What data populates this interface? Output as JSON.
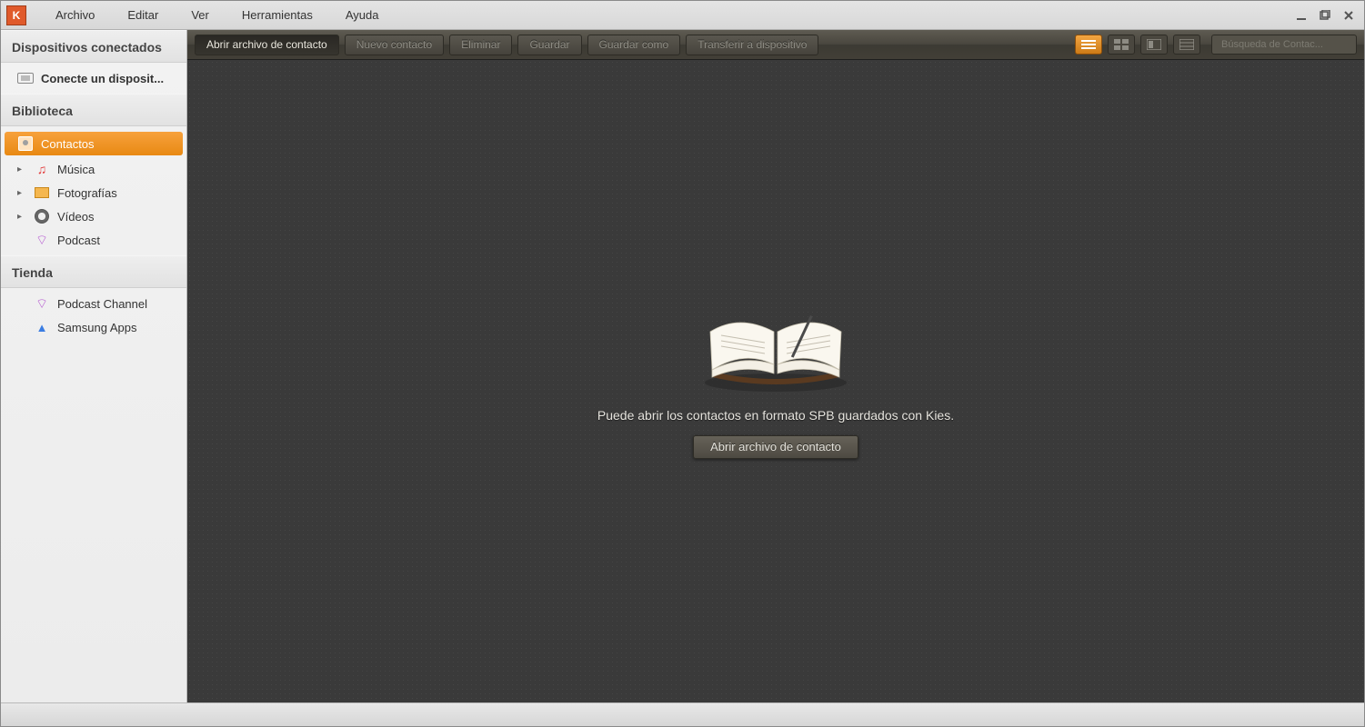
{
  "app_icon_letter": "K",
  "menu": {
    "archivo": "Archivo",
    "editar": "Editar",
    "ver": "Ver",
    "herramientas": "Herramientas",
    "ayuda": "Ayuda"
  },
  "sidebar": {
    "devices_title": "Dispositivos conectados",
    "connect_device": "Conecte un disposit...",
    "library_title": "Biblioteca",
    "library": {
      "contactos": "Contactos",
      "musica": "Música",
      "fotografias": "Fotografías",
      "videos": "Vídeos",
      "podcast": "Podcast"
    },
    "store_title": "Tienda",
    "store": {
      "podcast_channel": "Podcast Channel",
      "samsung_apps": "Samsung Apps"
    }
  },
  "toolbar": {
    "open_contact": "Abrir archivo de contacto",
    "new_contact": "Nuevo contacto",
    "delete": "Eliminar",
    "save": "Guardar",
    "save_as": "Guardar como",
    "transfer": "Transferir a dispositivo",
    "search_placeholder": "Búsqueda de Contac..."
  },
  "content": {
    "message": "Puede abrir los contactos en formato SPB guardados con Kies.",
    "button": "Abrir archivo de contacto"
  },
  "colors": {
    "accent": "#ed8d1e",
    "dark_bg": "#3a3a3a"
  }
}
